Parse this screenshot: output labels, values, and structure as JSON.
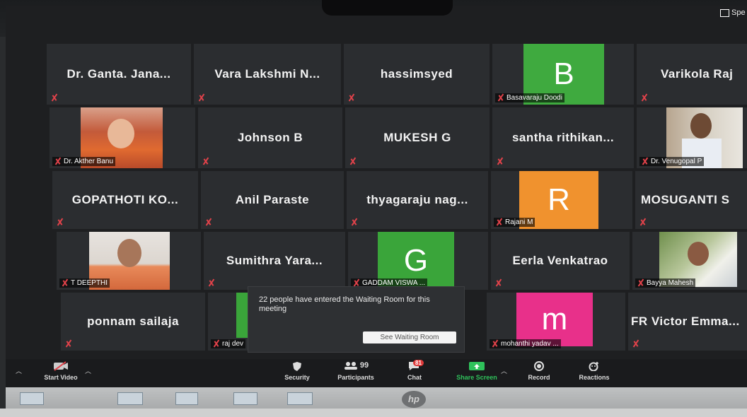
{
  "top_right": {
    "speaker_label": "Spe"
  },
  "grid": {
    "row1": {
      "t1": "Dr. Ganta. Jana...",
      "t2": "Vara Lakshmi N...",
      "t3": "hassimsyed",
      "t4_avatar": "B",
      "t4_label": "Basavaraju Doodi",
      "t5": "Varikola Raj"
    },
    "row2": {
      "t1_label": "Dr. Akther Banu",
      "t2": "Johnson B",
      "t3": "MUKESH G",
      "t4": "santha rithikan...",
      "t5_label": "Dr. Venugopal P"
    },
    "row3": {
      "t1": "GOPATHOTI KO...",
      "t2": "Anil Paraste",
      "t3": "thyagaraju nag...",
      "t4_avatar": "R",
      "t4_label": "Rajani M",
      "t5": "MOSUGANTI S"
    },
    "row4": {
      "t1_label": "T DEEPTHI",
      "t2": "Sumithra Yara...",
      "t3_avatar": "G",
      "t3_label": "GADDAM VISWA ...",
      "t4": "Eerla Venkatrao",
      "t5_label": "Bayya Mahesh"
    },
    "row5": {
      "t1": "ponnam sailaja",
      "t2_label": "raj dev",
      "t4_avatar": "m",
      "t4_label": "mohanthi yadav ...",
      "t5": "FR Victor Emma..."
    }
  },
  "waiting_popup": {
    "message": "22 people have entered the Waiting Room for this meeting",
    "button": "See Waiting Room"
  },
  "toolbar": {
    "start_video": "Start Video",
    "security": "Security",
    "participants": "Participants",
    "participants_count": "99",
    "chat": "Chat",
    "chat_badge": "81",
    "share_screen": "Share Screen",
    "record": "Record",
    "reactions": "Reactions"
  },
  "colors": {
    "avatar_b": "#3faa3f",
    "avatar_r": "#f0922e",
    "avatar_g": "#3aa53a",
    "avatar_m": "#e8308a",
    "muted_red": "#e2424a",
    "share_green": "#2fc25b"
  },
  "brand": {
    "hp": "hp"
  }
}
